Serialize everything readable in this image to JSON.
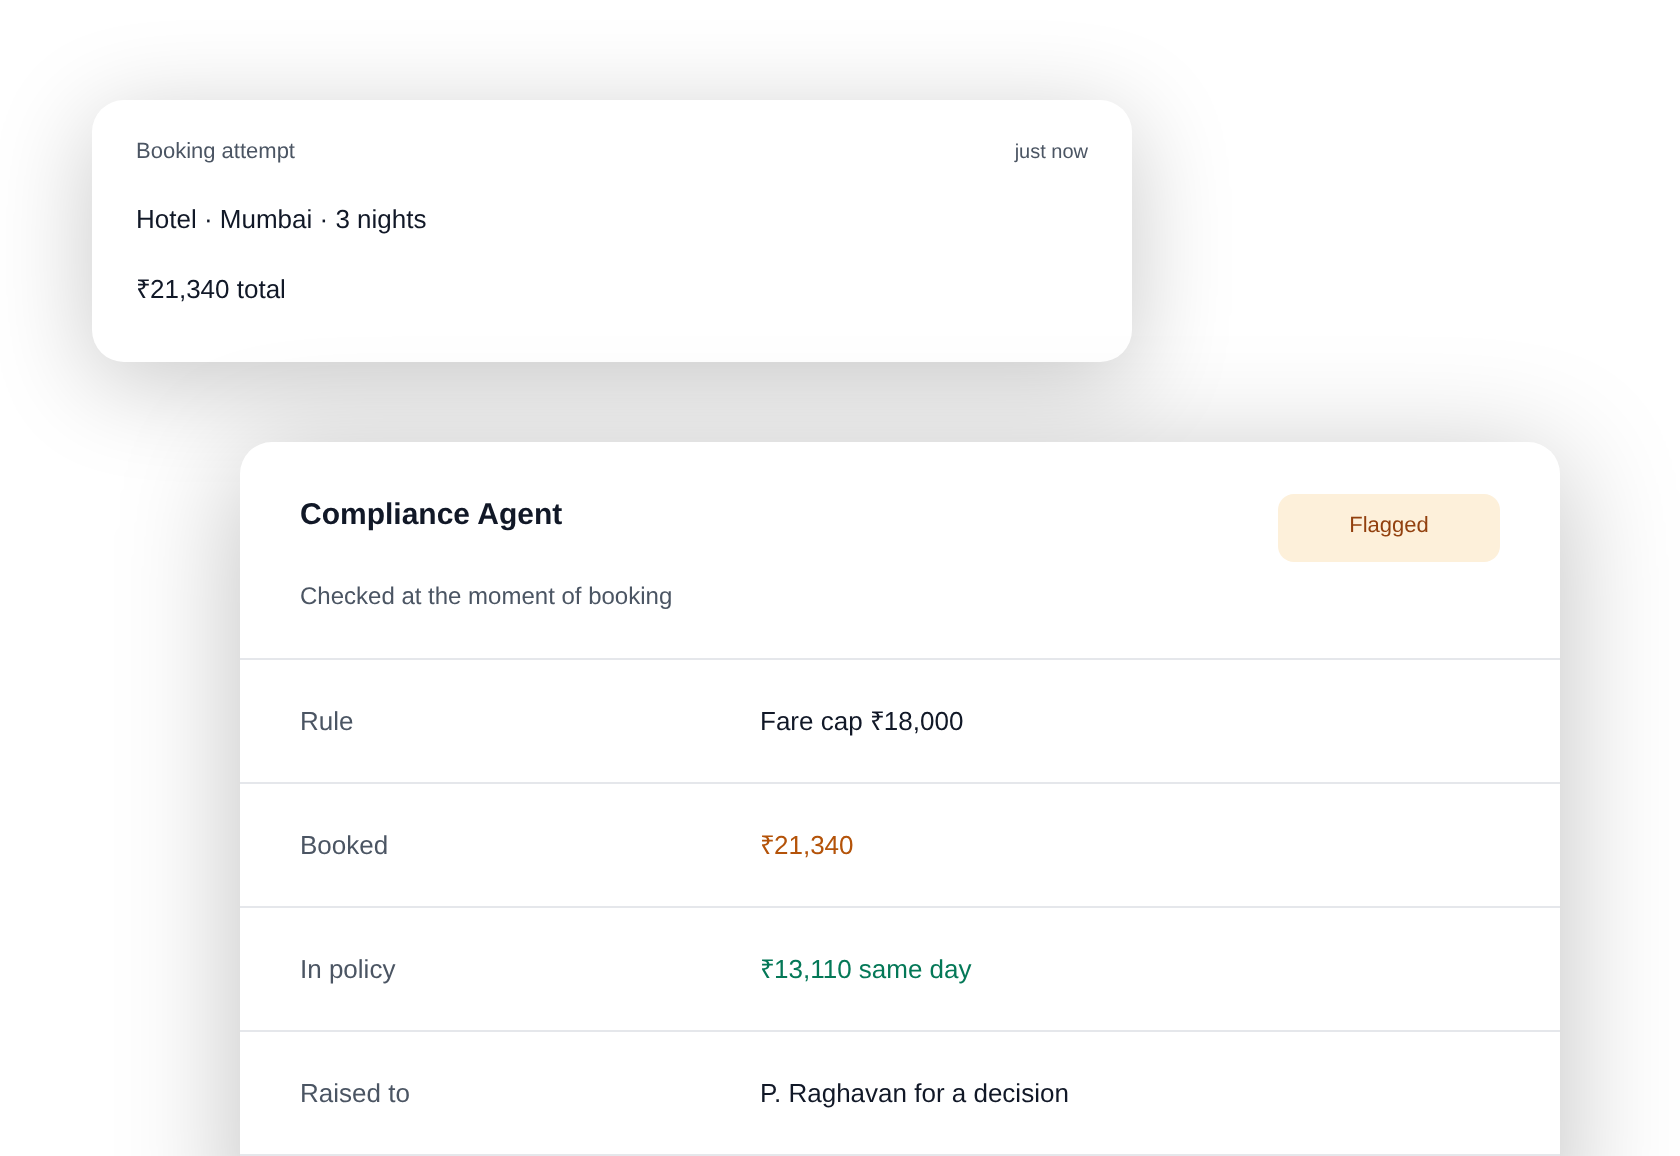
{
  "booking": {
    "label": "Booking attempt",
    "time": "just now",
    "summary": "Hotel · Mumbai · 3 nights",
    "total": "₹21,340 total"
  },
  "agent": {
    "title": "Compliance Agent",
    "subtitle": "Checked at the moment of booking",
    "status": "Flagged",
    "rows": [
      {
        "label": "Rule",
        "value": "Fare cap ₹18,000",
        "kind": "plain"
      },
      {
        "label": "Booked",
        "value": "₹21,340",
        "kind": "warning"
      },
      {
        "label": "In policy",
        "value": "₹13,110 same day",
        "kind": "success"
      },
      {
        "label": "Raised to",
        "value": "P. Raghavan for a decision",
        "kind": "plain"
      }
    ]
  }
}
